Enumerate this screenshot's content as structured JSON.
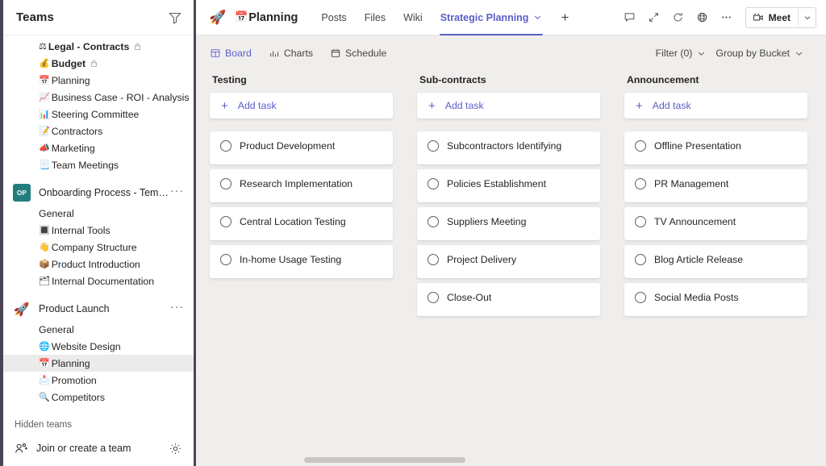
{
  "sidebar": {
    "title": "Teams",
    "filter_icon": "filter-icon",
    "loose_channels": [
      {
        "label": "Legal - Contracts",
        "emoji": "⚖",
        "bold": true,
        "locked": true
      },
      {
        "label": "Budget",
        "emoji": "💰",
        "bold": true,
        "locked": true
      },
      {
        "label": "Planning",
        "emoji": "📅",
        "bold": false,
        "locked": false
      },
      {
        "label": "Business Case - ROI - Analysis",
        "emoji": "📈",
        "bold": false,
        "locked": false
      },
      {
        "label": "Steering Committee",
        "emoji": "📊",
        "bold": false,
        "locked": false
      },
      {
        "label": "Contractors",
        "emoji": "📝",
        "bold": false,
        "locked": false
      },
      {
        "label": "Marketing",
        "emoji": "📣",
        "bold": false,
        "locked": false
      },
      {
        "label": "Team Meetings",
        "emoji": "📃",
        "bold": false,
        "locked": false
      }
    ],
    "teams": [
      {
        "name": "Onboarding Process - Template",
        "avatar_initials": "OP",
        "avatar_color": "#227d7d",
        "avatar_emoji": "",
        "more_label": "···",
        "channels": [
          {
            "label": "General",
            "emoji": ""
          },
          {
            "label": "Internal Tools",
            "emoji": "🔳"
          },
          {
            "label": "Company Structure",
            "emoji": "👋"
          },
          {
            "label": "Product Introduction",
            "emoji": "📦"
          },
          {
            "label": "Internal Documentation",
            "emoji": "🗂"
          }
        ]
      },
      {
        "name": "Product Launch",
        "avatar_initials": "",
        "avatar_color": "transparent",
        "avatar_emoji": "🚀",
        "more_label": "···",
        "channels": [
          {
            "label": "General",
            "emoji": ""
          },
          {
            "label": "Website Design",
            "emoji": "🌐"
          },
          {
            "label": "Planning",
            "emoji": "📅",
            "selected": true
          },
          {
            "label": "Promotion",
            "emoji": "📩"
          },
          {
            "label": "Competitors",
            "emoji": "🔍"
          }
        ]
      }
    ],
    "hidden_teams_label": "Hidden teams",
    "join_create_label": "Join or create a team",
    "join_icon": "add-people-icon",
    "settings_icon": "gear-icon"
  },
  "header": {
    "channel_emoji": "🚀",
    "channel_name": "Planning",
    "channel_name_emoji": "📅",
    "tabs": [
      {
        "label": "Posts",
        "active": false,
        "caret": false
      },
      {
        "label": "Files",
        "active": false,
        "caret": false
      },
      {
        "label": "Wiki",
        "active": false,
        "caret": false
      },
      {
        "label": "Strategic Planning",
        "active": true,
        "caret": true
      }
    ],
    "add_tab_label": "+",
    "right_icons": [
      {
        "name": "chat-icon"
      },
      {
        "name": "expand-icon"
      },
      {
        "name": "refresh-icon"
      },
      {
        "name": "globe-icon"
      },
      {
        "name": "more-options-icon"
      }
    ],
    "meet_label": "Meet",
    "meet_icon": "video-camera-icon",
    "meet_caret_icon": "chevron-down-icon",
    "accent_color": "#5b5fc7"
  },
  "planner_toolbar": {
    "views": [
      {
        "label": "Board",
        "icon": "board-icon",
        "active": true
      },
      {
        "label": "Charts",
        "icon": "charts-icon",
        "active": false
      },
      {
        "label": "Schedule",
        "icon": "schedule-icon",
        "active": false
      }
    ],
    "filter_label": "Filter (0)",
    "group_by_label": "Group by Bucket",
    "caret_icon": "chevron-down-icon"
  },
  "board": {
    "add_task_label": "Add task",
    "add_task_icon": "plus-icon",
    "buckets": [
      {
        "title": "Testing",
        "tasks": [
          "Product Development",
          "Research Implementation",
          "Central Location Testing",
          "In-home Usage Testing"
        ]
      },
      {
        "title": "Sub-contracts",
        "tasks": [
          "Subcontractors Identifying",
          "Policies Establishment",
          "Suppliers Meeting",
          "Project Delivery",
          "Close-Out"
        ]
      },
      {
        "title": "Announcement",
        "tasks": [
          "Offline Presentation",
          "PR Management",
          "TV Announcement",
          "Blog Article Release",
          "Social Media Posts"
        ]
      }
    ]
  },
  "scrollbar": {
    "name": "horizontal-scrollbar"
  }
}
